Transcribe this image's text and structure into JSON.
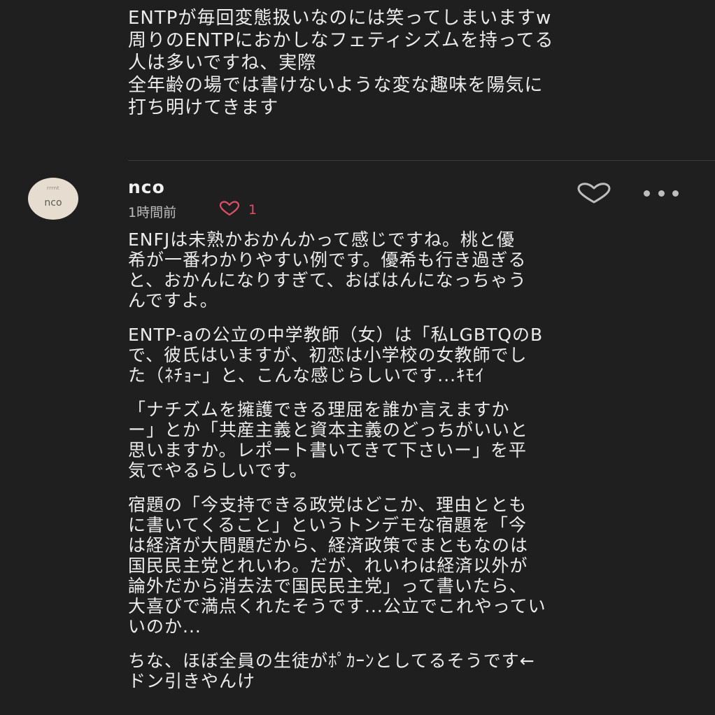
{
  "previous_comment": {
    "lines": [
      "ENTPが毎回変態扱いなのには笑ってしまいますw",
      "周りのENTPにおかしなフェティシズムを持ってる",
      "人は多いですね、実際",
      "全年齢の場では書けないような変な趣味を陽気に",
      "打ち明けてきます"
    ]
  },
  "comment": {
    "avatar": {
      "tiny_text": "rrrnt",
      "name": "nco"
    },
    "username": "nco",
    "timestamp": "1時間前",
    "like_count": "1",
    "accent_color": "#e04f68",
    "paragraphs": [
      [
        "ENFJは未熟かおかんかって感じですね。桃と優",
        "希が一番わかりやすい例です。優希も行き過ぎる",
        "と、おかんになりすぎて、おばはんになっちゃう",
        "んですよ。"
      ],
      [
        "ENTP-aの公立の中学教師（女）は「私LGBTQのB",
        "で、彼氏はいますが、初恋は小学校の女教師でし",
        "た（ﾈﾁｮｰ」と、こんな感じらしいです...ｷﾓｲ"
      ],
      [
        "「ナチズムを擁護できる理屈を誰か言えますか",
        "ー」とか「共産主義と資本主義のどっちがいいと",
        "思いますか。レポート書いてきて下さいー」を平",
        "気でやるらしいです。"
      ],
      [
        "宿題の「今支持できる政党はどこか、理由ととも",
        "に書いてくること」というトンデモな宿題を「今",
        "は経済が大問題だから、経済政策でまともなのは",
        "国民民主党とれいわ。だが、れいわは経済以外が",
        "論外だから消去法で国民民主党」って書いたら、",
        "大喜びで満点くれたそうです...公立でこれやってい",
        "いのか..."
      ],
      [
        "ちな、ほぼ全員の生徒がﾎﾟｶｰﾝとしてるそうです←",
        "ドン引きやんけ"
      ]
    ]
  },
  "icons": {
    "like_mini": "heart-outline-icon",
    "like_button": "heart-outline-icon",
    "more": "more-horizontal-icon"
  }
}
